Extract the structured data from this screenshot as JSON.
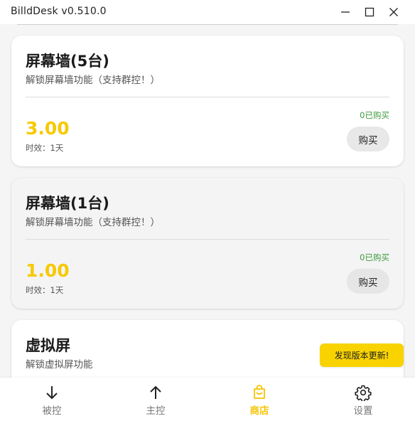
{
  "window": {
    "title": "BilldDesk v0.510.0"
  },
  "products": [
    {
      "name": "屏幕墙(5台)",
      "description": "解锁屏幕墙功能（支持群控！）",
      "sold": "0已购买",
      "price": "3.00",
      "validity": "时效：1天",
      "buy_label": "购买"
    },
    {
      "name": "屏幕墙(1台)",
      "description": "解锁屏幕墙功能（支持群控！）",
      "sold": "0已购买",
      "price": "1.00",
      "validity": "时效：1天",
      "buy_label": "购买"
    },
    {
      "name": "虚拟屏",
      "description": "解锁虚拟屏功能"
    }
  ],
  "toast": {
    "text": "发现版本更新!"
  },
  "bottom_nav": [
    {
      "label": "被控",
      "icon": "arrow-down-icon",
      "active": false
    },
    {
      "label": "主控",
      "icon": "arrow-up-icon",
      "active": false
    },
    {
      "label": "商店",
      "icon": "shopping-bag-icon",
      "active": true
    },
    {
      "label": "设置",
      "icon": "gear-icon",
      "active": false
    }
  ],
  "colors": {
    "accent": "#f5c400",
    "price": "#f7c900",
    "sold": "#3d9a3d",
    "toast_bg": "#f8d300"
  }
}
